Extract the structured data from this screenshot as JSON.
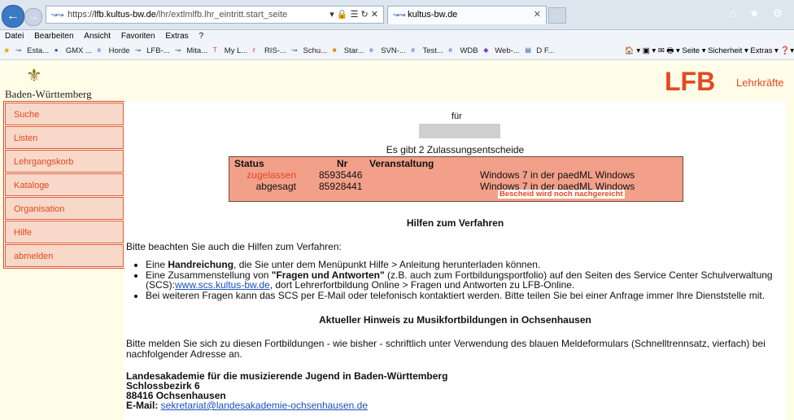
{
  "browser": {
    "address": {
      "favicon": "lfb-favicon",
      "proto": "https://",
      "host": "lfb.kultus-bw.de",
      "path": "/lhr/extlmlfb.lhr_eintritt.start_seite",
      "icons": "▾ 🔒 ☰ ↻ ✕"
    },
    "tab": {
      "title": "kultus-bw.de",
      "close": "✕"
    },
    "window_icons": "⌂ ★ ⚙",
    "menu": [
      "Datei",
      "Bearbeiten",
      "Ansicht",
      "Favoriten",
      "Extras",
      "?"
    ],
    "favorites": [
      "Esta...",
      "GMX ...",
      "Horde",
      "LFB-...",
      "Mita...",
      "My L...",
      "RIS-...",
      "Schu...",
      "Star...",
      "SVN-...",
      "Test...",
      "WDB",
      "Web-...",
      "D F..."
    ],
    "commands": "🏠 ▾ ▣ ▾ ✉ 🖶 ▾  Seite ▾  Sicherheit ▾  Extras ▾  ❓▾"
  },
  "header": {
    "state": "Baden-Württemberg",
    "brand": "LFB",
    "brand_sub": "Lehrkräfte"
  },
  "sidebar": {
    "items": [
      "Suche",
      "Listen",
      "Lehrgangskorb",
      "Kataloge",
      "Organisation",
      "Hilfe",
      "abmelden"
    ]
  },
  "main": {
    "fuer": "für",
    "count": "Es gibt 2 Zulassungsentscheide",
    "table": {
      "headers": [
        "Status",
        "Nr",
        "Veranstaltung"
      ],
      "rows": [
        {
          "status": "zugelassen",
          "nr": "85935446",
          "veranstaltung": "Windows 7 in der paedML Windows",
          "status_color": "#e4481f"
        },
        {
          "status": "abgesagt",
          "nr": "85928441",
          "veranstaltung": "Windows 7 in der paedML Windows",
          "status_color": "#111111"
        }
      ],
      "hint": "Bescheid wird noch nachgereicht"
    },
    "help_title": "Hilfen zum Verfahren",
    "help_intro": "Bitte beachten Sie auch die Hilfen zum Verfahren:",
    "bullet1_pre": "Eine ",
    "bullet1_bold": "Handreichung",
    "bullet1_post": ", die Sie unter dem Menüpunkt Hilfe > Anleitung herunterladen können.",
    "bullet2_pre": "Eine Zusammenstellung von ",
    "bullet2_bold": "\"Fragen und Antworten\"",
    "bullet2_post": " (z.B. auch zum Fortbildungsportfolio) auf den Seiten des Service Center Schulverwaltung (SCS):",
    "bullet2_link": "www.scs.kultus-bw.de",
    "bullet2_tail": ", dort Lehrerfortbildung Online > Fragen und Antworten zu LFB-Online.",
    "bullet3": "Bei weiteren Fragen kann das SCS per E-Mail oder telefonisch kontaktiert werden. Bitte teilen Sie bei einer Anfrage immer Ihre Dienststelle mit.",
    "music_title": "Aktueller Hinweis zu Musikfortbildungen in Ochsenhausen",
    "music_text": "Bitte melden Sie sich zu diesen Fortbildungen - wie bisher - schriftlich unter Verwendung des blauen Meldeformulars (Schnelltrennsatz, vierfach) bei nachfolgender Adresse an.",
    "addr_line1": "Landesakademie für die musizierende Jugend in Baden-Württemberg",
    "addr_line2": "Schlossbezirk 6",
    "addr_line3": "88416 Ochsenhausen",
    "addr_email_label": "E-Mail: ",
    "addr_email": "sekretariat@landesakademie-ochsenhausen.de"
  }
}
